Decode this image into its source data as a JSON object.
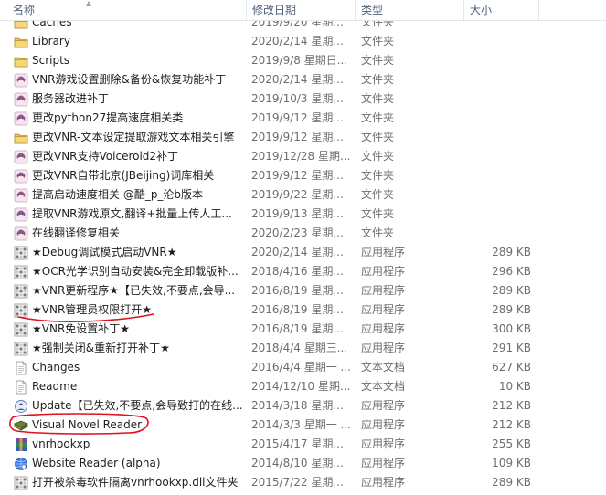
{
  "header": {
    "name": "名称",
    "date": "修改日期",
    "type": "类型",
    "size": "大小"
  },
  "rows": [
    {
      "name": "Caches",
      "date": "2019/9/20 星期...",
      "type": "文件夹",
      "size": "",
      "icon": "folder-icon"
    },
    {
      "name": "Library",
      "date": "2020/2/14 星期...",
      "type": "文件夹",
      "size": "",
      "icon": "folder-icon"
    },
    {
      "name": "Scripts",
      "date": "2019/9/8 星期日...",
      "type": "文件夹",
      "size": "",
      "icon": "folder-icon"
    },
    {
      "name": "VNR游戏设置删除&备份&恢复功能补丁",
      "date": "2020/2/14 星期...",
      "type": "文件夹",
      "size": "",
      "icon": "anime-girl-folder-icon"
    },
    {
      "name": "服务器改进补丁",
      "date": "2019/10/3 星期...",
      "type": "文件夹",
      "size": "",
      "icon": "anime-girl-folder-icon"
    },
    {
      "name": "更改python27提高速度相关类",
      "date": "2019/9/12 星期...",
      "type": "文件夹",
      "size": "",
      "icon": "anime-girl-folder-icon"
    },
    {
      "name": "更改VNR-文本设定提取游戏文本相关引擎",
      "date": "2019/9/12 星期...",
      "type": "文件夹",
      "size": "",
      "icon": "folder-icon"
    },
    {
      "name": "更改VNR支持Voiceroid2补丁",
      "date": "2019/12/28 星期...",
      "type": "文件夹",
      "size": "",
      "icon": "anime-girl-folder-icon"
    },
    {
      "name": "更改VNR自带北京(JBeijing)词库相关",
      "date": "2019/9/12 星期...",
      "type": "文件夹",
      "size": "",
      "icon": "anime-girl-folder-icon"
    },
    {
      "name": "提高启动速度相关 @酷_p_沦b版本",
      "date": "2019/9/22 星期...",
      "type": "文件夹",
      "size": "",
      "icon": "anime-girl-folder-icon"
    },
    {
      "name": "提取VNR游戏原文,翻译+批量上传人工...",
      "date": "2019/9/13 星期...",
      "type": "文件夹",
      "size": "",
      "icon": "anime-girl-folder-icon"
    },
    {
      "name": "在线翻译修复相关",
      "date": "2020/2/23 星期...",
      "type": "文件夹",
      "size": "",
      "icon": "anime-girl-folder-icon"
    },
    {
      "name": "★Debug调试模式启动VNR★",
      "date": "2020/2/14 星期...",
      "type": "应用程序",
      "size": "289 KB",
      "icon": "app-icon"
    },
    {
      "name": "★OCR光学识别自动安装&完全卸载版补...",
      "date": "2018/4/16 星期...",
      "type": "应用程序",
      "size": "296 KB",
      "icon": "app-icon"
    },
    {
      "name": "★VNR更新程序★【已失效,不要点,会导...",
      "date": "2016/8/19 星期...",
      "type": "应用程序",
      "size": "289 KB",
      "icon": "app-icon"
    },
    {
      "name": "★VNR管理员权限打开★",
      "date": "2016/8/19 星期...",
      "type": "应用程序",
      "size": "289 KB",
      "icon": "app-icon"
    },
    {
      "name": "★VNR免设置补丁★",
      "date": "2016/8/19 星期...",
      "type": "应用程序",
      "size": "300 KB",
      "icon": "app-icon"
    },
    {
      "name": "★强制关闭&重新打开补丁★",
      "date": "2018/4/4 星期三...",
      "type": "应用程序",
      "size": "291 KB",
      "icon": "app-icon"
    },
    {
      "name": "Changes",
      "date": "2016/4/4 星期一 ...",
      "type": "文本文档",
      "size": "627 KB",
      "icon": "text-file-icon"
    },
    {
      "name": "Readme",
      "date": "2014/12/10 星期...",
      "type": "文本文档",
      "size": "10 KB",
      "icon": "text-file-icon"
    },
    {
      "name": "Update【已失效,不要点,会导致打的在线...",
      "date": "2014/3/18 星期...",
      "type": "应用程序",
      "size": "212 KB",
      "icon": "update-app-icon"
    },
    {
      "name": "Visual Novel Reader",
      "date": "2014/3/3 星期一 ...",
      "type": "应用程序",
      "size": "212 KB",
      "icon": "vnr-book-icon"
    },
    {
      "name": "vnrhookxp",
      "date": "2015/4/17 星期...",
      "type": "应用程序",
      "size": "255 KB",
      "icon": "winrar-icon"
    },
    {
      "name": "Website Reader (alpha)",
      "date": "2014/8/10 星期...",
      "type": "应用程序",
      "size": "109 KB",
      "icon": "globe-app-icon"
    },
    {
      "name": "打开被杀毒软件隔离vnrhookxp.dll文件夹",
      "date": "2015/7/22 星期...",
      "type": "应用程序",
      "size": "289 KB",
      "icon": "app-icon"
    }
  ],
  "colors": {
    "header_text": "#4c607a",
    "annotation_red": "#e0101e",
    "muted_text": "#6d6d6d"
  }
}
